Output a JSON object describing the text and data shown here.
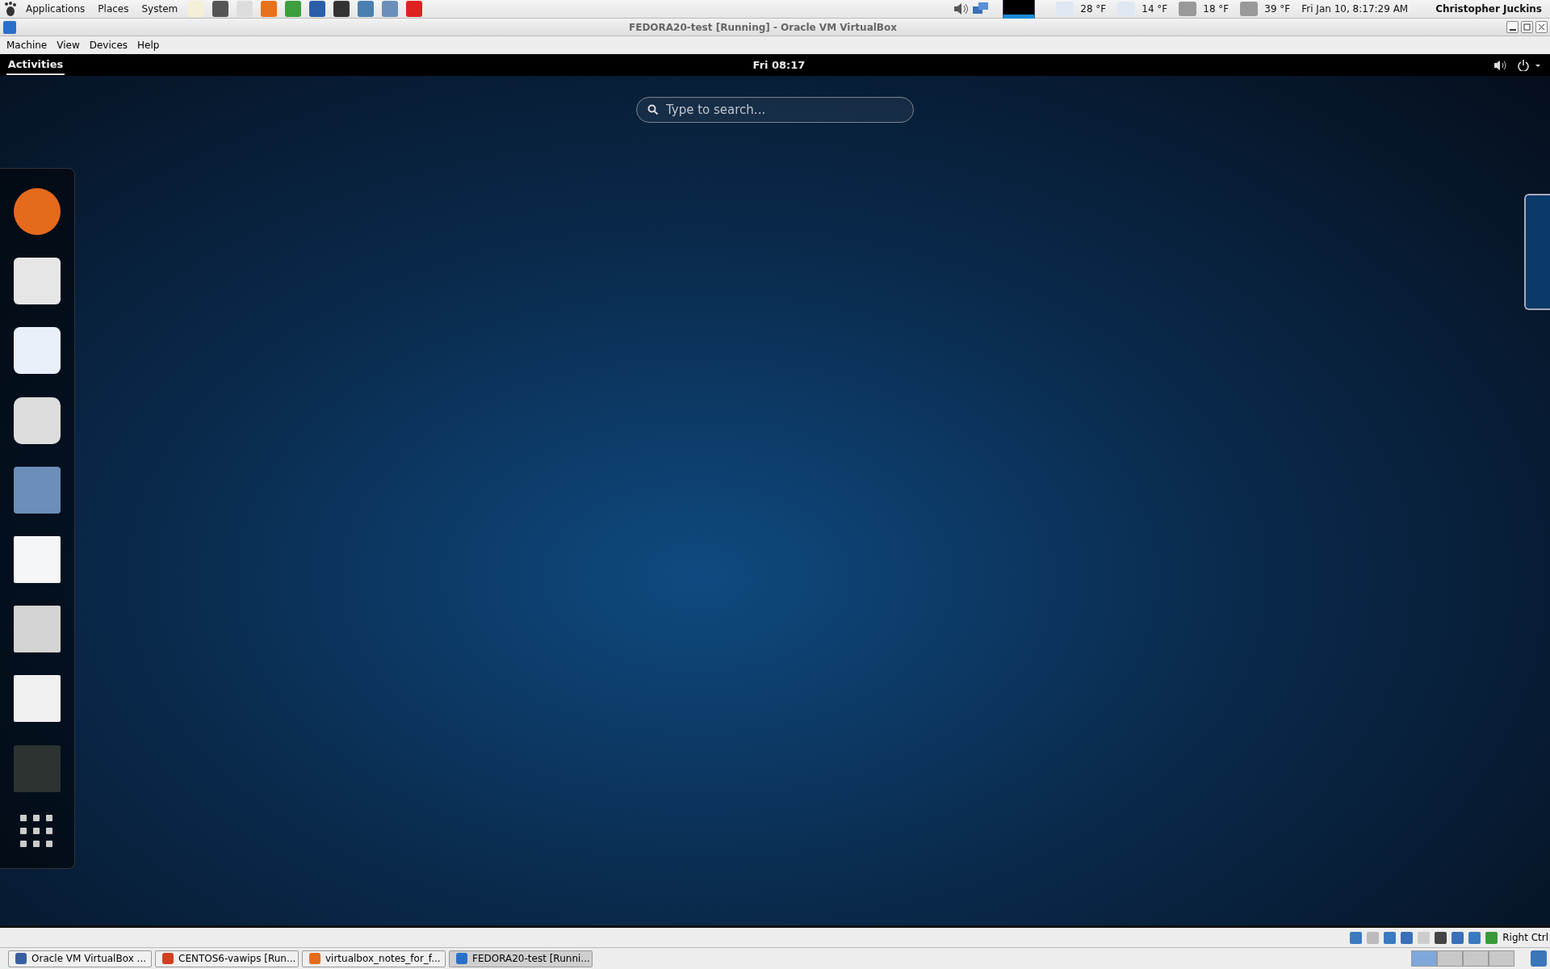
{
  "top_panel": {
    "menus": [
      "Applications",
      "Places",
      "System"
    ],
    "weather": [
      {
        "reading": "28 °F"
      },
      {
        "reading": "14 °F"
      },
      {
        "reading": "18 °F"
      },
      {
        "reading": "39 °F"
      }
    ],
    "clock": "Fri Jan 10,  8:17:29 AM",
    "user": "Christopher Juckins"
  },
  "window": {
    "title": "FEDORA20-test [Running] - Oracle VM VirtualBox",
    "menus": [
      "Machine",
      "View",
      "Devices",
      "Help"
    ]
  },
  "shell": {
    "activities": "Activities",
    "clock": "Fri 08:17",
    "search": {
      "placeholder": "Type to search..."
    }
  },
  "status_bar": {
    "host_key": "Right Ctrl"
  },
  "taskbar": {
    "tasks": [
      {
        "label": "Oracle VM VirtualBox ...",
        "selected": false
      },
      {
        "label": "CENTOS6-vawips [Run...",
        "selected": false
      },
      {
        "label": "virtualbox_notes_for_f...",
        "selected": false
      },
      {
        "label": "FEDORA20-test [Runni...",
        "selected": true
      }
    ],
    "workspaces": [
      {
        "selected": true
      },
      {
        "selected": false
      },
      {
        "selected": false
      },
      {
        "selected": false
      }
    ]
  }
}
